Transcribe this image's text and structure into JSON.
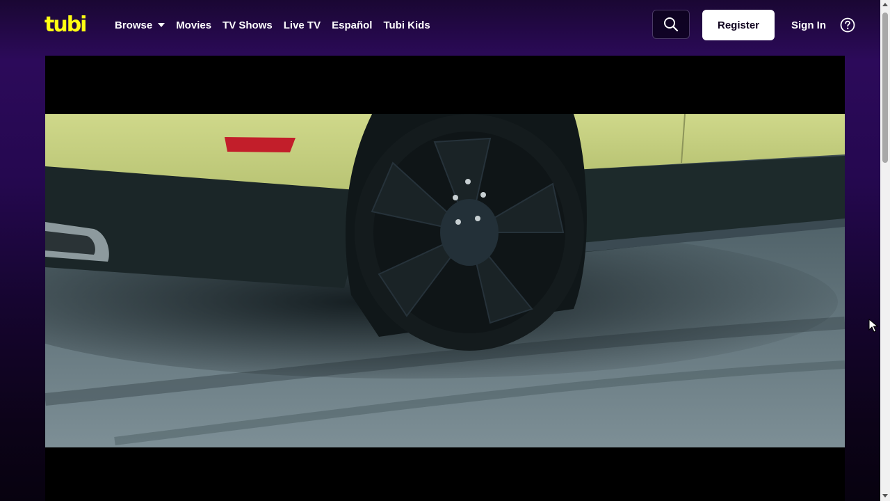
{
  "header": {
    "logo_text": "tubi",
    "nav": [
      {
        "label": "Browse",
        "has_dropdown": true
      },
      {
        "label": "Movies"
      },
      {
        "label": "TV Shows"
      },
      {
        "label": "Live TV"
      },
      {
        "label": "Español"
      },
      {
        "label": "Tubi Kids"
      }
    ],
    "search_icon": "search-icon",
    "register_label": "Register",
    "signin_label": "Sign In",
    "help_icon": "help-circle-icon"
  },
  "player": {
    "frame_description_icon": "video-frame"
  },
  "colors": {
    "brand_yellow": "#ffff13",
    "header_purple": "#2c0a5a",
    "car_yellow": "#c9d27a",
    "road_gray": "#6d8088"
  }
}
